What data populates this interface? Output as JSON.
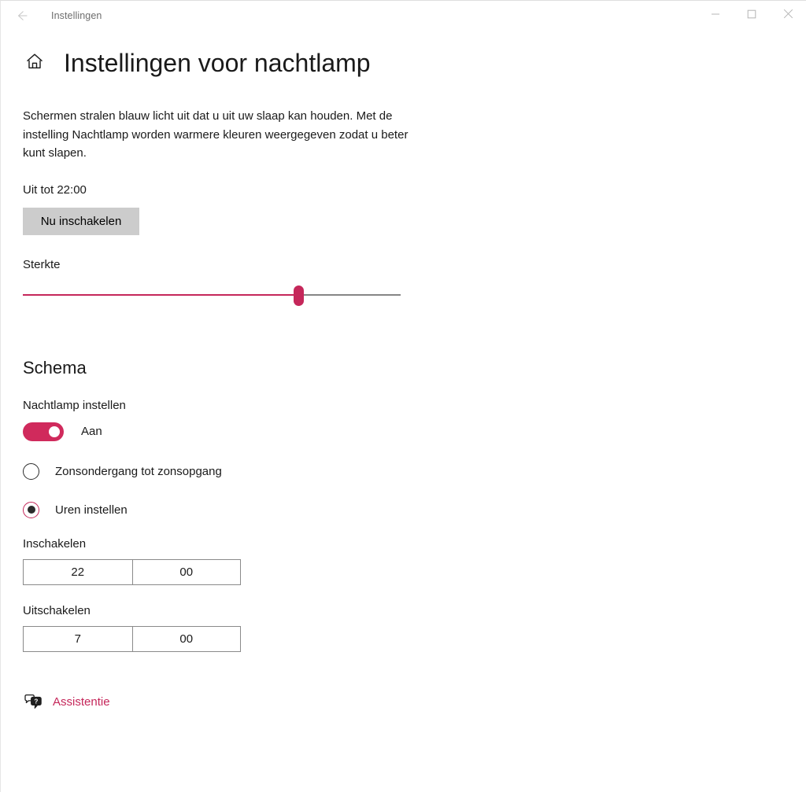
{
  "window": {
    "app_title": "Instellingen",
    "back_icon": "back-arrow-icon",
    "caption": {
      "minimize": "minimize-icon",
      "maximize": "maximize-icon",
      "close": "close-icon"
    }
  },
  "header": {
    "home_icon": "home-icon",
    "page_title": "Instellingen voor nachtlamp"
  },
  "main": {
    "description": "Schermen stralen blauw licht uit dat u uit uw slaap kan houden. Met de instelling Nachtlamp worden warmere kleuren weergegeven zodat u beter kunt slapen.",
    "status_text": "Uit tot 22:00",
    "enable_now_label": "Nu inschakelen",
    "strength_label": "Sterkte",
    "strength_value": 73,
    "schema_heading": "Schema",
    "schedule_label": "Nachtlamp instellen",
    "toggle_state_label": "Aan",
    "toggle_on": true,
    "radios": [
      {
        "label": "Zonsondergang tot zonsopgang",
        "selected": false
      },
      {
        "label": "Uren instellen",
        "selected": true
      }
    ],
    "turn_on_label": "Inschakelen",
    "turn_on_hours": "22",
    "turn_on_minutes": "00",
    "turn_off_label": "Uitschakelen",
    "turn_off_hours": "7",
    "turn_off_minutes": "00",
    "help_icon": "help-question-bubble-icon",
    "help_link_label": "Assistentie"
  },
  "colors": {
    "accent": "#c5275a",
    "toggle_on": "#d02a5c",
    "button_bg": "#cccccc",
    "track_bg": "#868686",
    "text": "#1a1a1a"
  }
}
